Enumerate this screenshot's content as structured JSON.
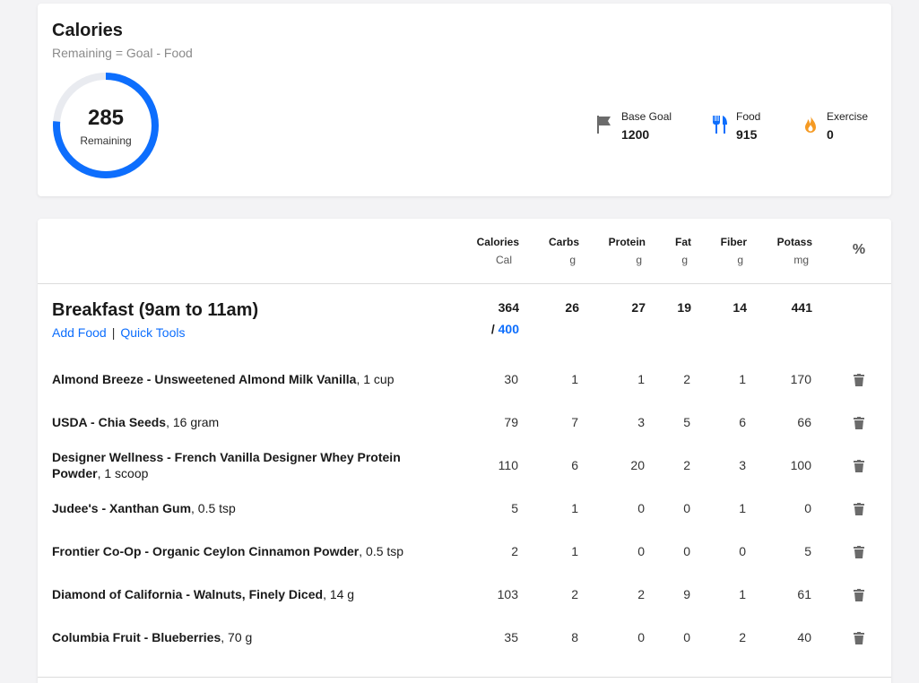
{
  "calories": {
    "title": "Calories",
    "formula": "Remaining = Goal - Food",
    "remaining_value": "285",
    "remaining_label": "Remaining",
    "remaining_fraction": 0.7625,
    "stats": [
      {
        "icon": "flag-icon",
        "label": "Base Goal",
        "value": "1200"
      },
      {
        "icon": "fork-knife-icon",
        "label": "Food",
        "value": "915"
      },
      {
        "icon": "flame-icon",
        "label": "Exercise",
        "value": "0"
      }
    ]
  },
  "colors": {
    "accent": "#0d6efd",
    "ring_track": "#e9ebf0",
    "flame": "#f59a23",
    "icon_gray": "#6b6b6b"
  },
  "columns": [
    {
      "name": "Calories",
      "unit": "Cal"
    },
    {
      "name": "Carbs",
      "unit": "g"
    },
    {
      "name": "Protein",
      "unit": "g"
    },
    {
      "name": "Fat",
      "unit": "g"
    },
    {
      "name": "Fiber",
      "unit": "g"
    },
    {
      "name": "Potass",
      "unit": "mg"
    }
  ],
  "percent_header": "%",
  "meal": {
    "title": "Breakfast (9am to 11am)",
    "add_food": "Add Food",
    "separator": "|",
    "quick_tools": "Quick Tools",
    "totals": [
      "364",
      "26",
      "27",
      "19",
      "14",
      "441"
    ],
    "goal_prefix": "/ ",
    "goal": "400",
    "foods": [
      {
        "name": "Almond Breeze - Unsweetened Almond Milk Vanilla",
        "serving": ", 1 cup",
        "values": [
          "30",
          "1",
          "1",
          "2",
          "1",
          "170"
        ]
      },
      {
        "name": "USDA - Chia Seeds",
        "serving": ", 16 gram",
        "values": [
          "79",
          "7",
          "3",
          "5",
          "6",
          "66"
        ]
      },
      {
        "name": "Designer Wellness - French Vanilla Designer Whey Protein Powder",
        "serving": ", 1 scoop",
        "values": [
          "110",
          "6",
          "20",
          "2",
          "3",
          "100"
        ]
      },
      {
        "name": "Judee's - Xanthan Gum",
        "serving": ", 0.5 tsp",
        "values": [
          "5",
          "1",
          "0",
          "0",
          "1",
          "0"
        ]
      },
      {
        "name": "Frontier Co-Op - Organic Ceylon Cinnamon Powder",
        "serving": ", 0.5 tsp",
        "values": [
          "2",
          "1",
          "0",
          "0",
          "0",
          "5"
        ]
      },
      {
        "name": "Diamond of California - Walnuts, Finely Diced",
        "serving": ", 14 g",
        "values": [
          "103",
          "2",
          "2",
          "9",
          "1",
          "61"
        ]
      },
      {
        "name": "Columbia Fruit - Blueberries",
        "serving": ", 70 g",
        "values": [
          "35",
          "8",
          "0",
          "0",
          "2",
          "40"
        ]
      }
    ]
  }
}
